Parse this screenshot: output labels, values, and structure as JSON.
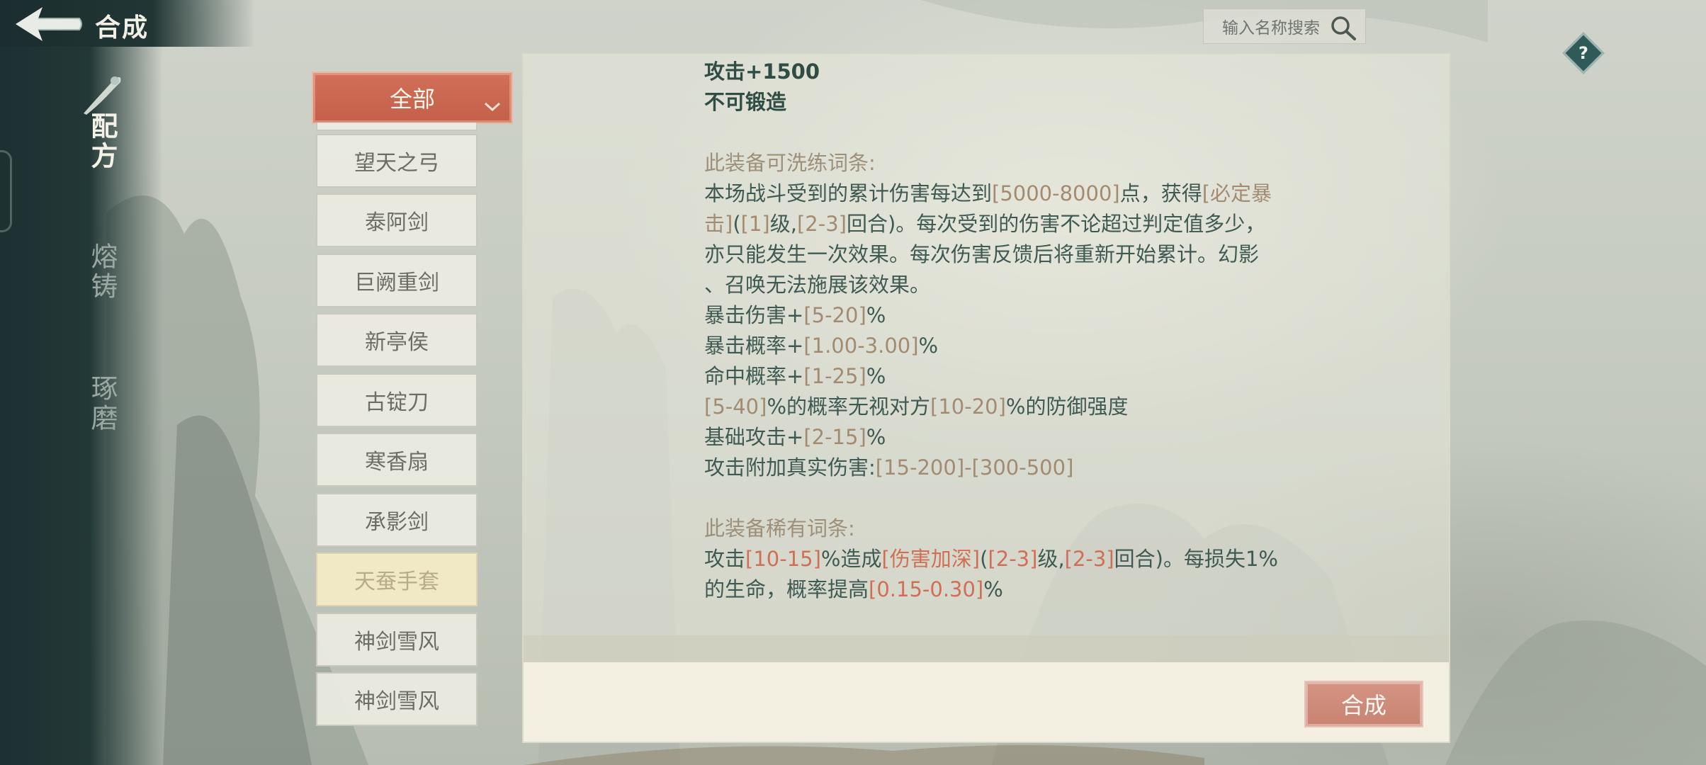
{
  "header": {
    "title": "合成"
  },
  "search": {
    "placeholder": "输入名称搜索"
  },
  "help": {
    "label": "?"
  },
  "sidebar": {
    "tabs": [
      {
        "label": "配方",
        "active": true
      },
      {
        "label": "熔铸",
        "active": false
      },
      {
        "label": "琢磨",
        "active": false
      }
    ]
  },
  "filter": {
    "label": "全部"
  },
  "items": [
    {
      "label": "望天之弓"
    },
    {
      "label": "泰阿剑"
    },
    {
      "label": "巨阙重剑"
    },
    {
      "label": "新亭侯"
    },
    {
      "label": "古锭刀"
    },
    {
      "label": "寒香扇"
    },
    {
      "label": "承影剑"
    },
    {
      "label": "天蚕手套",
      "selected": true
    },
    {
      "label": "神剑雪风"
    },
    {
      "label": "神剑雪风"
    }
  ],
  "detail": {
    "attack": "攻击+1500",
    "not_forgeable": "不可锻造",
    "refine_title": "此装备可洗练词条:",
    "refine_para": [
      [
        {
          "t": "本场战斗受到的累计伤害每达到"
        },
        {
          "t": "[5000-8000]",
          "c": "val"
        },
        {
          "t": "点，获得"
        },
        {
          "t": "[必定暴",
          "c": "val"
        }
      ],
      [
        {
          "t": "击]",
          "c": "val"
        },
        {
          "t": "("
        },
        {
          "t": "[1]",
          "c": "val"
        },
        {
          "t": "级,"
        },
        {
          "t": "[2-3]",
          "c": "val"
        },
        {
          "t": "回合)。每次受到的伤害不论超过判定值多少，"
        }
      ],
      [
        {
          "t": "亦只能发生一次效果。每次伤害反馈后将重新开始累计。幻影"
        }
      ],
      [
        {
          "t": "、召唤无法施展该效果。"
        }
      ],
      [
        {
          "t": "暴击伤害+"
        },
        {
          "t": "[5-20]",
          "c": "val"
        },
        {
          "t": "%"
        }
      ],
      [
        {
          "t": "暴击概率+"
        },
        {
          "t": "[1.00-3.00]",
          "c": "val"
        },
        {
          "t": "%"
        }
      ],
      [
        {
          "t": "命中概率+"
        },
        {
          "t": "[1-25]",
          "c": "val"
        },
        {
          "t": "%"
        }
      ],
      [
        {
          "t": "[5-40]",
          "c": "val"
        },
        {
          "t": "%的概率无视对方"
        },
        {
          "t": "[10-20]",
          "c": "val"
        },
        {
          "t": "%的防御强度"
        }
      ],
      [
        {
          "t": "基础攻击+"
        },
        {
          "t": "[2-15]",
          "c": "val"
        },
        {
          "t": "%"
        }
      ],
      [
        {
          "t": "攻击附加真实伤害:"
        },
        {
          "t": "[15-200]-[300-500]",
          "c": "val"
        }
      ]
    ],
    "rare_title": "此装备稀有词条:",
    "rare_para": [
      [
        {
          "t": "攻击"
        },
        {
          "t": "[10-15]",
          "c": "red"
        },
        {
          "t": "%造成"
        },
        {
          "t": "[伤害加深]",
          "c": "red"
        },
        {
          "t": "("
        },
        {
          "t": "[2-3]",
          "c": "red"
        },
        {
          "t": "级,"
        },
        {
          "t": "[2-3]",
          "c": "red"
        },
        {
          "t": "回合)。每损失1%"
        }
      ],
      [
        {
          "t": "的生命，概率提高"
        },
        {
          "t": "[0.15-0.30]",
          "c": "red"
        },
        {
          "t": "%"
        }
      ]
    ]
  },
  "synth_button": {
    "label": "合成"
  },
  "colors": {
    "accent_red": "#c4604a",
    "value_text": "#a38b72",
    "rare_text": "#d06f56",
    "main_text": "#3f5a52"
  }
}
